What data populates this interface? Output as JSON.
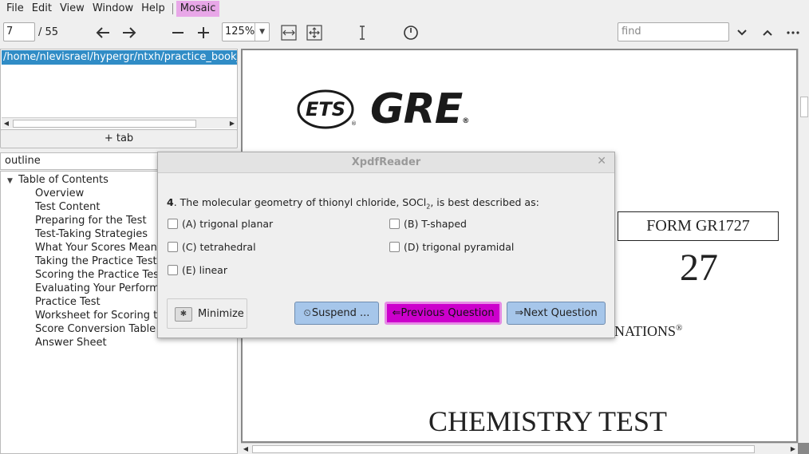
{
  "menubar": {
    "items": [
      "File",
      "Edit",
      "View",
      "Window",
      "Help"
    ],
    "extra": "Mosaic"
  },
  "toolbar": {
    "page_value": "7",
    "page_total": "/ 55",
    "zoom_value": "125%",
    "find_placeholder": "find"
  },
  "left_panel": {
    "tab_path": "/home/nlevisrael/hypergr/ntxh/practice_book_chem",
    "add_tab_label": "+ tab",
    "outline_label": "outline",
    "tree_root": "Table of Contents",
    "tree_items": [
      "Overview",
      "Test Content",
      "Preparing for the Test",
      "Test-Taking Strategies",
      "What Your Scores Mean",
      "Taking the Practice Test",
      "Scoring the Practice Test",
      "Evaluating Your Performance",
      "Practice Test",
      "Worksheet for Scoring the Practice Test",
      "Score Conversion Table",
      "Answer Sheet"
    ]
  },
  "document": {
    "ets_logo": "ETS",
    "gre_logo": "GRE",
    "form_label": "FORM  GR1727",
    "form_number": "27",
    "exams_text": "NATIONS",
    "title": "CHEMISTRY TEST"
  },
  "dialog": {
    "title": "XpdfReader",
    "question_number": "4",
    "question_text_pre": ". The molecular geometry of thionyl chloride, SOCl",
    "question_sub": "2",
    "question_text_post": ", is best described as:",
    "choices": [
      "(A) trigonal planar",
      "(B) T-shaped",
      "(C) tetrahedral",
      "(D) trigonal pyramidal",
      "(E) linear"
    ],
    "minimize_label": "Minimize",
    "suspend_label": "Suspend ...",
    "previous_label": "Previous Question",
    "next_label": "Next Question"
  },
  "colors": {
    "selection_blue": "#308cc6",
    "mosaic_pink": "#e8a7e8",
    "prev_magenta": "#cc00cc",
    "button_blue": "#a6c6ea"
  }
}
